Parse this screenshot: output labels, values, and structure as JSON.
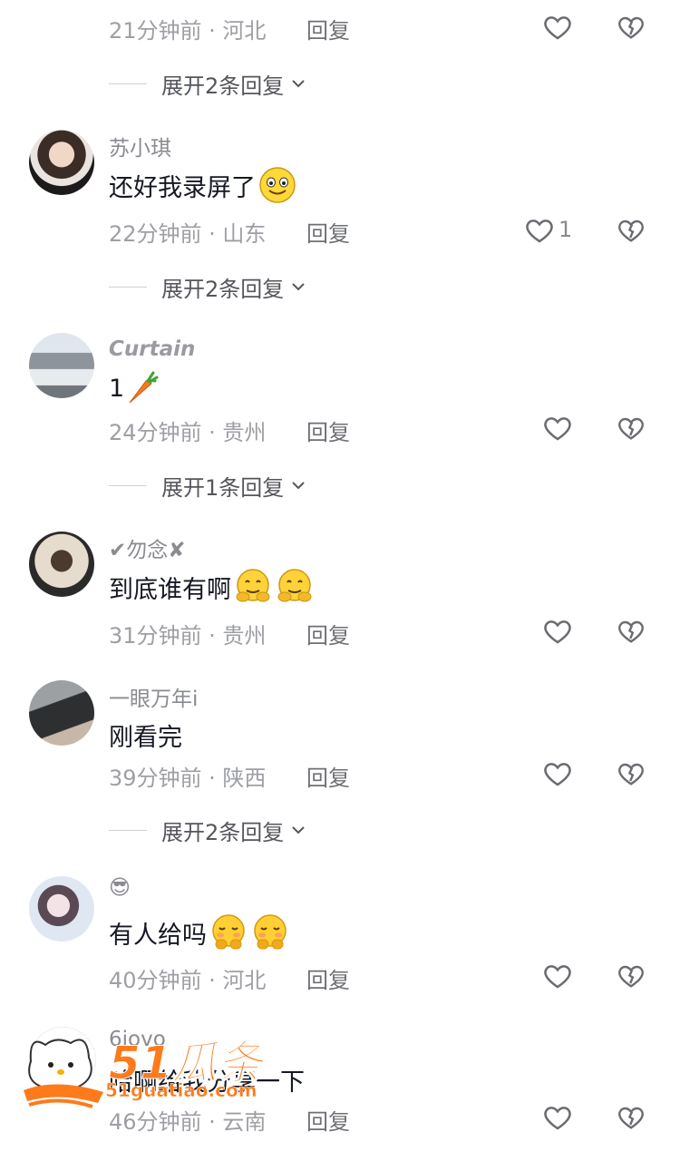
{
  "reply_label": "回复",
  "comments": [
    {
      "id": "c0",
      "meta": "21分钟前 · 河北",
      "expand": "展开2条回复"
    },
    {
      "id": "c1",
      "username": "苏小琪",
      "text": "还好我录屏了",
      "emoji": "smile-emoji",
      "meta": "22分钟前 · 山东",
      "likes": "1",
      "expand": "展开2条回复"
    },
    {
      "id": "c2",
      "username": "Curtain",
      "text": "1",
      "emoji": "carrot-emoji",
      "meta": "24分钟前 · 贵州",
      "expand": "展开1条回复"
    },
    {
      "id": "c3",
      "username": "✔勿念✘",
      "text": "到底谁有啊",
      "emoji": "hug-emoji",
      "meta": "31分钟前 · 贵州"
    },
    {
      "id": "c4",
      "username": "一眼万年i",
      "text": "刚看完",
      "meta": "39分钟前 · 陕西",
      "expand": "展开2条回复"
    },
    {
      "id": "c5",
      "username": "😎",
      "text": "有人给吗",
      "emoji": "pleading-emoji",
      "meta": "40分钟前 · 河北"
    },
    {
      "id": "c6",
      "username": "6iovo",
      "text": "哈啊给我分享一下",
      "meta": "46分钟前 · 云南"
    }
  ],
  "watermark": {
    "brand": "51瓜条",
    "url": "51guatiao.com"
  },
  "colors": {
    "text": "#161823",
    "meta": "#9e9fa5",
    "username": "#8a8b91",
    "watermark": "#ff7a1a"
  }
}
